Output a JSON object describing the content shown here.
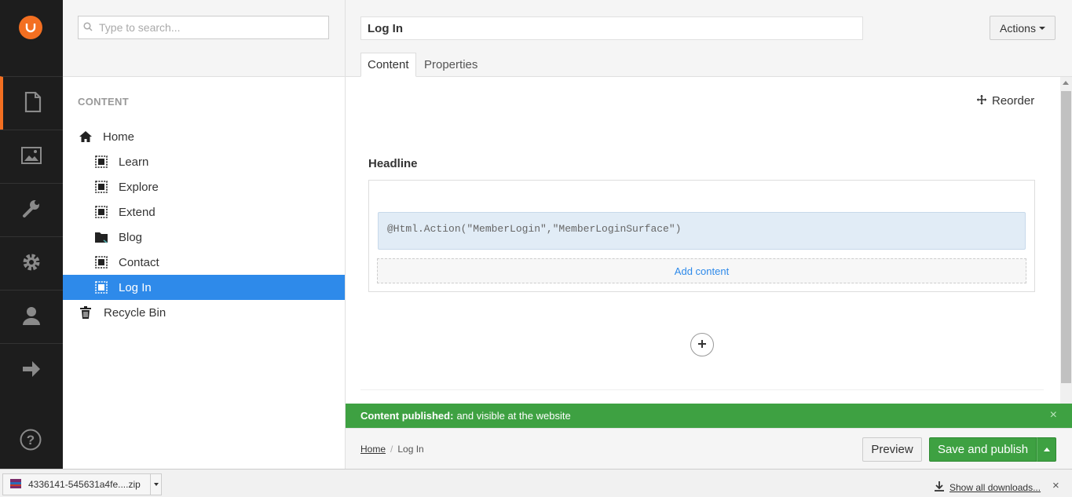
{
  "app": {
    "accent": "#f36f21",
    "selection": "#2e8aea",
    "success": "#3ea142"
  },
  "rail": {
    "logo_icon": "umbraco-logo-icon",
    "sections": [
      {
        "name": "content",
        "icon": "document-icon"
      },
      {
        "name": "media",
        "icon": "image-icon"
      },
      {
        "name": "settings",
        "icon": "wrench-icon"
      },
      {
        "name": "developer",
        "icon": "gear-icon"
      },
      {
        "name": "users",
        "icon": "user-icon"
      },
      {
        "name": "forms",
        "icon": "arrow-right-icon"
      }
    ],
    "help_icon": "help-icon"
  },
  "tree": {
    "search_placeholder": "Type to search...",
    "title": "CONTENT",
    "nodes": [
      {
        "label": "Home",
        "icon": "home-icon"
      },
      {
        "label": "Learn",
        "icon": "document-frame-icon"
      },
      {
        "label": "Explore",
        "icon": "document-frame-icon"
      },
      {
        "label": "Extend",
        "icon": "document-frame-icon"
      },
      {
        "label": "Blog",
        "icon": "folder-icon"
      },
      {
        "label": "Contact",
        "icon": "document-frame-icon"
      },
      {
        "label": "Log In",
        "icon": "document-frame-icon"
      },
      {
        "label": "Recycle Bin",
        "icon": "trash-icon"
      }
    ]
  },
  "editor": {
    "name_value": "Log In",
    "actions_label": "Actions",
    "tabs": [
      {
        "label": "Content"
      },
      {
        "label": "Properties"
      }
    ],
    "reorder_label": "Reorder",
    "headline_label": "Headline",
    "macro_text": "@Html.Action(\"MemberLogin\",\"MemberLoginSurface\")",
    "add_content_label": "Add content"
  },
  "notification": {
    "bold": "Content published:",
    "text": "and visible at the website",
    "close": "×"
  },
  "footer": {
    "breadcrumb": [
      {
        "label": "Home"
      },
      {
        "label": "Log In"
      }
    ],
    "breadcrumb_sep": "/",
    "preview_label": "Preview",
    "save_label": "Save and publish"
  },
  "downloads": {
    "file_name": "4336141-545631a4fe....zip",
    "show_all_label": "Show all downloads...",
    "close": "×"
  }
}
